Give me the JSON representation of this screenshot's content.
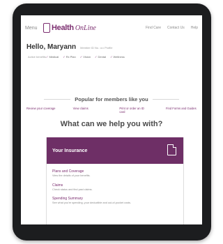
{
  "header": {
    "menu_label": "Menu",
    "logo_text": "Health",
    "logo_sub": "OnLine",
    "nav": [
      "Find Care",
      "Contact Us",
      "Help"
    ]
  },
  "greeting": {
    "hello": "Hello, Maryann",
    "member_info": "Member ID No. •••• Profile",
    "benefits_label": "Active benefits",
    "benefits": [
      "Medical",
      "Rx Plan",
      "Vision",
      "Dental",
      "Wellness"
    ]
  },
  "popular": {
    "title": "Popular for members like you",
    "links": [
      "Review your coverage",
      "View claims",
      "Print or order an ID card",
      "Find Forms and Guides"
    ]
  },
  "help_title": "What can we help you with?",
  "card": {
    "title": "Your Insurance",
    "items": [
      {
        "title": "Plans and Coverage",
        "desc": "View the details of your benefits."
      },
      {
        "title": "Claims",
        "desc": "Check status and find past claims."
      },
      {
        "title": "Spending Summary",
        "desc": "See what you're spending, your deductible and out-of-pocket costs."
      }
    ]
  }
}
